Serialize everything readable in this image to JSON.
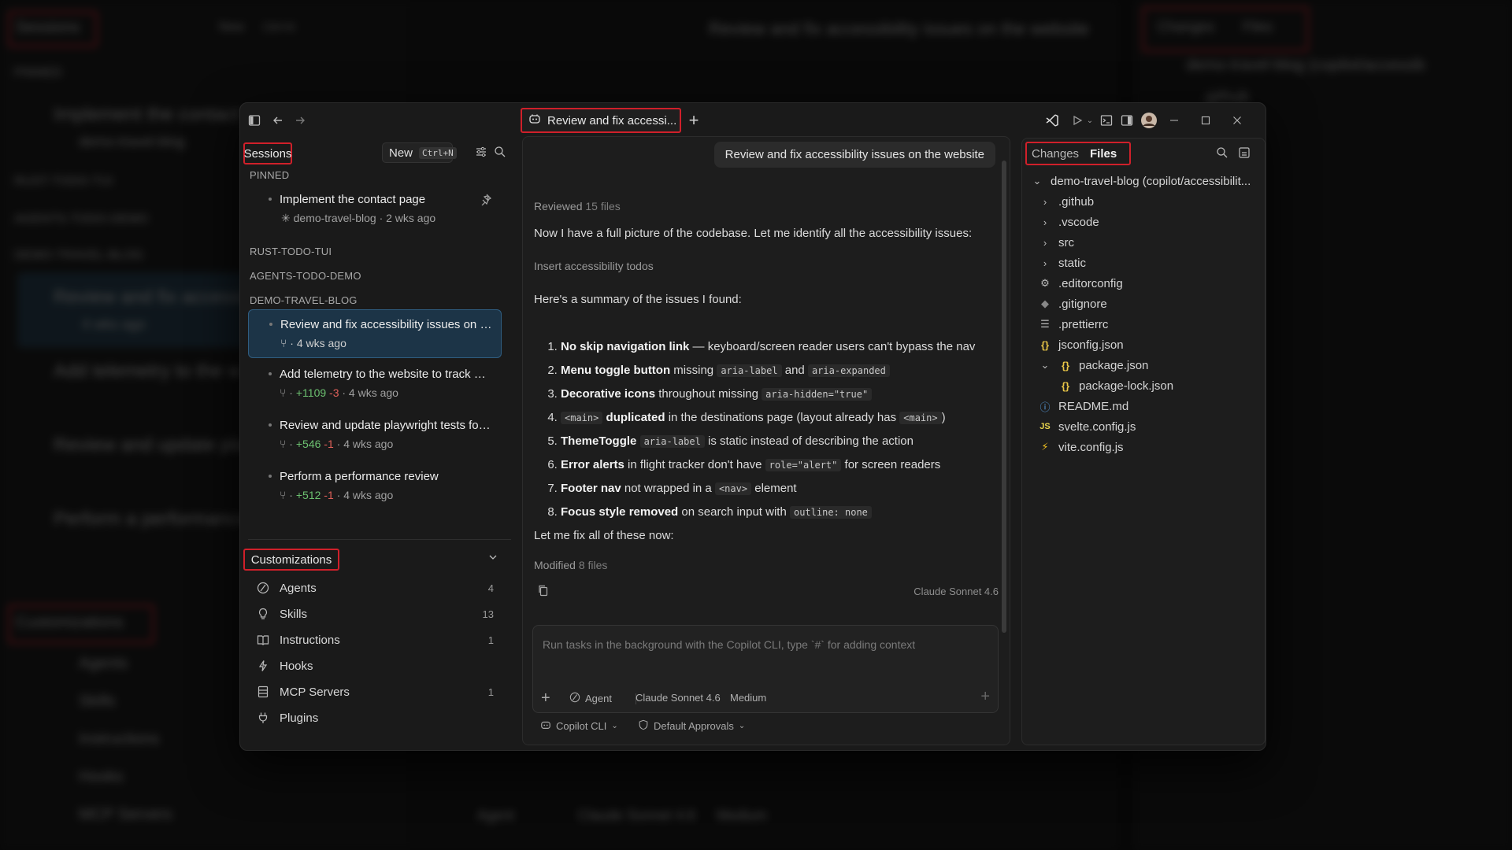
{
  "background": {
    "sessions_title": "Sessions",
    "new_label": "New",
    "new_shortcut": "Ctrl+N",
    "chat_title": "Review and fix accessibility issues on the website",
    "pinned": "PINNED",
    "item_1": "Implement the contact",
    "item_1_meta": "demo-travel-blog",
    "group_1": "RUST-TODO-TUI",
    "group_2": "AGENTS-TODO-DEMO",
    "group_3": "DEMO-TRAVEL-BLOG",
    "item_2": "Review and fix accessib",
    "item_2_meta": "4 wks ago",
    "item_3": "Add telemetry to the w",
    "item_4": "Review and update play",
    "item_5": "Perform a performance",
    "customizations": "Customizations",
    "cust_agents": "Agents",
    "cust_skills": "Skills",
    "cust_instructions": "Instructions",
    "cust_hooks": "Hooks",
    "cust_mcp": "MCP Servers",
    "right_changes": "Changes",
    "right_files": "Files",
    "right_root": "demo-travel-blog (copilot/accessib",
    "right_github": ".github",
    "bottom_agent": "Agent",
    "bottom_model": "Claude Sonnet 4.6",
    "bottom_effort": "Medium"
  },
  "titlebar": {
    "tab_title": "Review and fix accessi..."
  },
  "sidebar": {
    "sessions_label": "Sessions",
    "new_button": "New",
    "new_shortcut": "Ctrl+N",
    "pinned_header": "PINNED",
    "pinned_session": {
      "title": "Implement the contact page",
      "meta": "demo-travel-blog · 2 wks ago"
    },
    "groups": [
      "RUST-TODO-TUI",
      "AGENTS-TODO-DEMO",
      "DEMO-TRAVEL-BLOG"
    ],
    "sessions": [
      {
        "title": "Review and fix accessibility issues on the ...",
        "meta": "· 4 wks ago"
      },
      {
        "title": "Add telemetry to the website to track pa...",
        "plus": "+1109",
        "minus": "-3",
        "meta": "· 4 wks ago"
      },
      {
        "title": "Review and update playwright tests for al...",
        "plus": "+546",
        "minus": "-1",
        "meta": "· 4 wks ago"
      },
      {
        "title": "Perform a performance review",
        "plus": "+512",
        "minus": "-1",
        "meta": "· 4 wks ago"
      }
    ],
    "customizations_label": "Customizations",
    "customizations": [
      {
        "label": "Agents",
        "count": "4"
      },
      {
        "label": "Skills",
        "count": "13"
      },
      {
        "label": "Instructions",
        "count": "1"
      },
      {
        "label": "Hooks",
        "count": ""
      },
      {
        "label": "MCP Servers",
        "count": "1"
      },
      {
        "label": "Plugins",
        "count": ""
      }
    ]
  },
  "chat": {
    "user_message": "Review and fix accessibility issues on the website",
    "reviewed_label": "Reviewed",
    "reviewed_count": "15 files",
    "intro": "Now I have a full picture of the codebase. Let me identify all the accessibility issues:",
    "insert_todos": "Insert accessibility todos",
    "summary_intro": "Here's a summary of the issues I found:",
    "issues": [
      {
        "bold": "No skip navigation link",
        "rest": " — keyboard/screen reader users can't bypass the nav"
      },
      {
        "bold": "Menu toggle button",
        "rest": " missing ",
        "code1": "aria-label",
        "mid": " and ",
        "code2": "aria-expanded"
      },
      {
        "bold": "Decorative icons",
        "rest": " throughout missing ",
        "code1": "aria-hidden=\"true\""
      },
      {
        "code0": "<main>",
        "bold": " duplicated",
        "rest": " in the destinations page (layout already has ",
        "code1": "<main>",
        "tail": ")"
      },
      {
        "bold": "ThemeToggle",
        "rest": " ",
        "code1": "aria-label",
        "tail": " is static instead of describing the action"
      },
      {
        "bold": "Error alerts",
        "rest": " in flight tracker don't have ",
        "code1": "role=\"alert\"",
        "tail": " for screen readers"
      },
      {
        "bold": "Footer nav",
        "rest": " not wrapped in a ",
        "code1": "<nav>",
        "tail": " element"
      },
      {
        "bold": "Focus style removed",
        "rest": " on search input with ",
        "code1": "outline: none"
      }
    ],
    "closing": "Let me fix all of these now:",
    "modified_label": "Modified",
    "modified_count": "8 files",
    "model_footer": "Claude Sonnet 4.6",
    "input_placeholder": "Run tasks in the background with the Copilot CLI, type `#` for adding context",
    "agent_mode": "Agent",
    "model_select": "Claude Sonnet 4.6",
    "effort_select": "Medium",
    "cli_select": "Copilot CLI",
    "approvals_select": "Default Approvals"
  },
  "files_panel": {
    "tab_changes": "Changes",
    "tab_files": "Files",
    "root": "demo-travel-blog (copilot/accessibilit...",
    "entries": [
      {
        "name": ".github",
        "kind": "folder"
      },
      {
        "name": ".vscode",
        "kind": "folder"
      },
      {
        "name": "src",
        "kind": "folder"
      },
      {
        "name": "static",
        "kind": "folder"
      },
      {
        "name": ".editorconfig",
        "kind": "gear"
      },
      {
        "name": ".gitignore",
        "kind": "git"
      },
      {
        "name": ".prettierrc",
        "kind": "lines"
      },
      {
        "name": "jsconfig.json",
        "kind": "json"
      },
      {
        "name": "package.json",
        "kind": "json-folder"
      },
      {
        "name": "package-lock.json",
        "kind": "json"
      },
      {
        "name": "README.md",
        "kind": "info"
      },
      {
        "name": "svelte.config.js",
        "kind": "js"
      },
      {
        "name": "vite.config.js",
        "kind": "vite"
      }
    ]
  },
  "colors": {
    "accent_red": "#d0202a",
    "selected_bg": "#1c3447",
    "added": "#6cc070",
    "removed": "#e0605a",
    "json_icon": "#e8c547",
    "js_icon": "#e8d44d",
    "info_icon": "#5aa3e8"
  }
}
